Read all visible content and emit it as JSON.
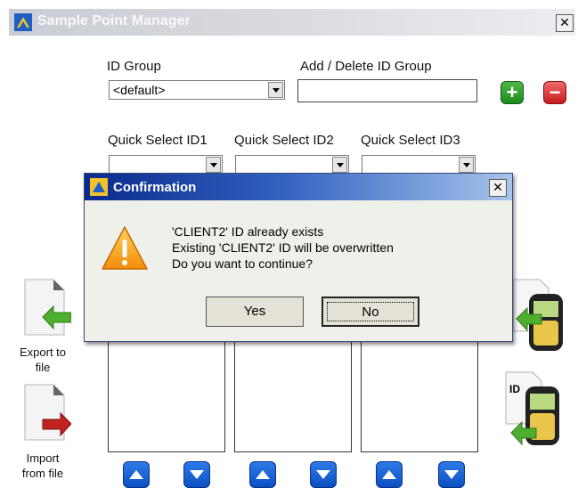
{
  "window": {
    "title": "Sample Point Manager",
    "close_glyph": "✕"
  },
  "id_group": {
    "label": "ID Group",
    "selected": "<default>",
    "add_delete_label": "Add / Delete ID Group",
    "add_delete_value": "",
    "add_glyph": "+",
    "delete_glyph": "−"
  },
  "quick_select": [
    {
      "label": "Quick Select ID1",
      "selected": ""
    },
    {
      "label": "Quick Select ID2",
      "selected": ""
    },
    {
      "label": "Quick Select ID3",
      "selected": ""
    }
  ],
  "side": {
    "export_label_1": "Export to",
    "export_label_2": "file",
    "import_label_1": "Import",
    "import_label_2": "from file",
    "device_id_text": "ID"
  },
  "dialog": {
    "title": "Confirmation",
    "close_glyph": "✕",
    "line1": "'CLIENT2' ID already exists",
    "line2": "Existing 'CLIENT2' ID will be overwritten",
    "line3": "Do you want to continue?",
    "yes_label": "Yes",
    "no_label": "No"
  },
  "icons": {
    "logo": "app-logo-icon",
    "warning": "warning-icon",
    "add": "plus-icon",
    "delete": "minus-icon",
    "up": "arrow-up-icon",
    "down": "arrow-down-icon"
  },
  "colors": {
    "add_green": "#1c8a1a",
    "delete_red": "#c51d1d",
    "arrow_blue": "#0b4fc1",
    "dialog_title_blue": "#0a2a8c"
  }
}
